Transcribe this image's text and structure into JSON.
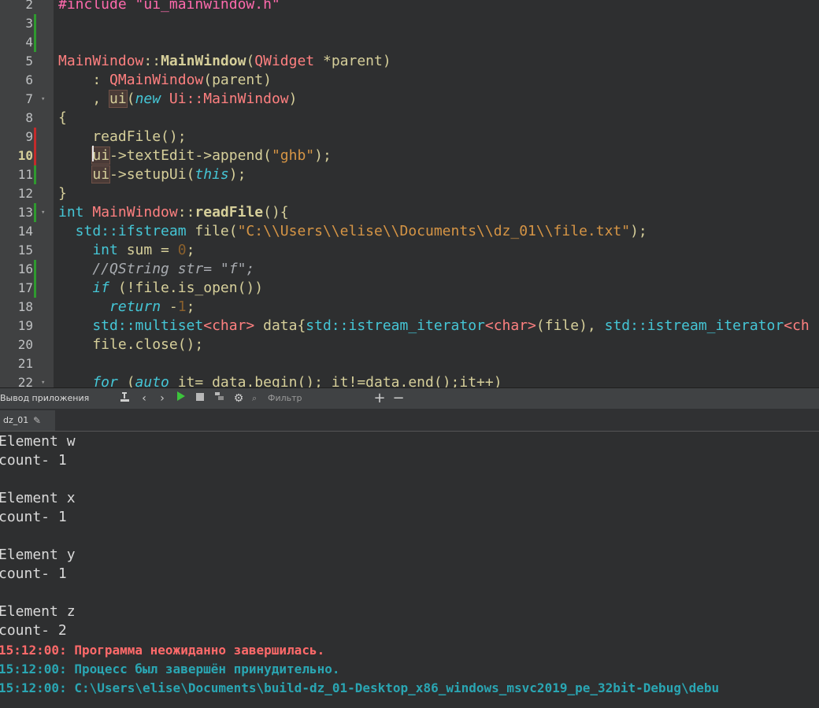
{
  "editor": {
    "line_numbers": [
      "2",
      "3",
      "4",
      "5",
      "6",
      "7",
      "8",
      "9",
      "10",
      "11",
      "12",
      "13",
      "14",
      "15",
      "16",
      "17",
      "18",
      "19",
      "20",
      "21",
      "22"
    ],
    "lines": {
      "l2": {
        "a": "#include \"ui_mainwindow.h\""
      },
      "l5": {
        "a": "MainWindow",
        "b": "::",
        "c": "MainWindow",
        "d": "(",
        "e": "QWidget",
        "f": " *parent)"
      },
      "l6": {
        "a": "    : ",
        "b": "QMainWindow",
        "c": "(parent)"
      },
      "l7": {
        "a": "    , ",
        "b": "ui",
        "c": "(",
        "d": "new",
        "e": " ",
        "f": "Ui::MainWindow",
        "g": ")"
      },
      "l8": {
        "a": "{"
      },
      "l9": {
        "a": "    readFile();"
      },
      "l10": {
        "a": "    ",
        "b": "ui",
        "c": "->textEdit->append(",
        "d": "\"ghb\"",
        "e": ");"
      },
      "l11": {
        "a": "    ",
        "b": "ui",
        "c": "->setupUi(",
        "d": "this",
        "e": ");"
      },
      "l12": {
        "a": "}"
      },
      "l13": {
        "a": "int",
        "b": " MainWindow",
        "c": "::",
        "d": "readFile",
        "e": "(){"
      },
      "l14": {
        "a": "  std::ifstream",
        "b": " file(",
        "c": "\"C:\\\\Users\\\\elise\\\\Documents\\\\dz_01\\\\file.txt\"",
        "d": ");"
      },
      "l15": {
        "a": "    int",
        "b": " sum = ",
        "c": "0",
        "d": ";"
      },
      "l16": {
        "a": "    //QString str= \"f\";"
      },
      "l17": {
        "a": "    if",
        "b": " (!file.is_open())"
      },
      "l18": {
        "a": "      return",
        "b": " -",
        "c": "1",
        "d": ";"
      },
      "l19": {
        "a": "    std::multiset",
        "b": "<char>",
        "c": " data{",
        "d": "std::istream_iterator",
        "e": "<char>",
        "f": "(file), ",
        "g": "std::istream_iterator",
        "h": "<ch"
      },
      "l20": {
        "a": "    file.close();"
      },
      "l22": {
        "a": "    for",
        "b": " (",
        "c": "auto",
        "d": " it= data.begin(); it!=data.end();it++)"
      }
    }
  },
  "output_pane": {
    "title": "Вывод приложения",
    "filter_placeholder": "Фильтр",
    "plus_label": "+",
    "minus_label": "−",
    "tab_label": "dz_01",
    "lines": [
      "Element w",
      "count- 1",
      "",
      "Element x",
      "count- 1",
      "",
      "Element y",
      "count- 1",
      "",
      "Element z",
      "count- 2"
    ],
    "error_line": "15:12:00: Программа неожиданно завершилась.",
    "info_line_1": "15:12:00: Процесс был завершён принудительно.",
    "info_line_2": "15:12:00: C:\\Users\\elise\\Documents\\build-dz_01-Desktop_x86_windows_msvc2019_pe_32bit-Debug\\debu"
  },
  "colors": {
    "editor_bg": "#2e2f30",
    "gutter_bg": "#404142",
    "marker_green": "#2f9a2f",
    "marker_red": "#c42b2b",
    "error_text": "#ff6a6a",
    "info_text": "#2aa6b3"
  },
  "icons": [
    "build-icon",
    "prev-icon",
    "next-icon",
    "run-icon",
    "stop-icon",
    "attach-icon",
    "settings-icon",
    "filter-icon",
    "zoom-in-icon",
    "zoom-out-icon",
    "pin-icon"
  ]
}
